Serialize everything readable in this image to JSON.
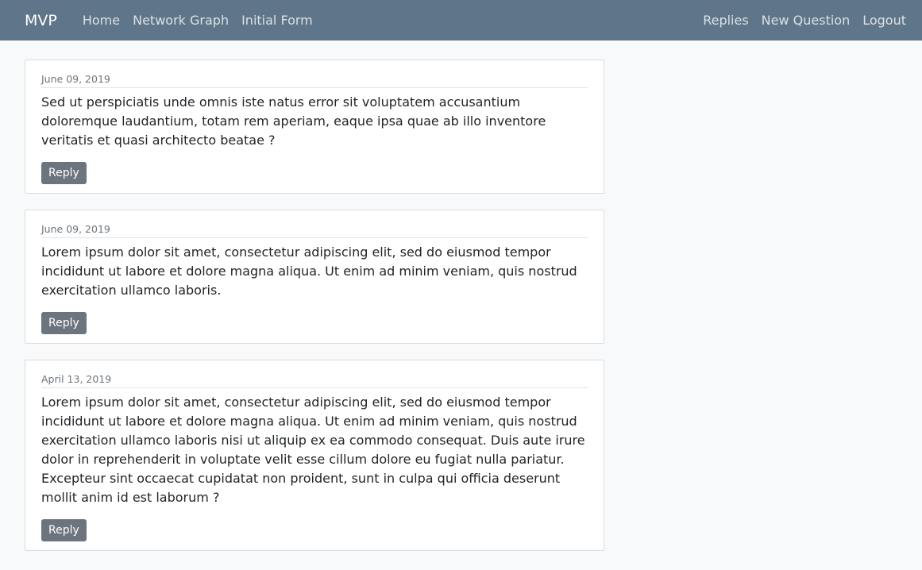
{
  "navbar": {
    "brand": "MVP",
    "left_links": [
      "Home",
      "Network Graph",
      "Initial Form"
    ],
    "right_links": [
      "Replies",
      "New Question",
      "Logout"
    ],
    "background": "#5f7589"
  },
  "questions": [
    {
      "date": "June 09, 2019",
      "text": "Sed ut perspiciatis unde omnis iste natus error sit voluptatem accusantium doloremque laudantium, totam rem aperiam, eaque ipsa quae ab illo inventore veritatis et quasi architecto beatae ?",
      "reply_label": "Reply"
    },
    {
      "date": "June 09, 2019",
      "text": "Lorem ipsum dolor sit amet, consectetur adipiscing elit, sed do eiusmod tempor incididunt ut labore et dolore magna aliqua. Ut enim ad minim veniam, quis nostrud exercitation ullamco laboris.",
      "reply_label": "Reply"
    },
    {
      "date": "April 13, 2019",
      "text": "Lorem ipsum dolor sit amet, consectetur adipiscing elit, sed do eiusmod tempor incididunt ut labore et dolore magna aliqua. Ut enim ad minim veniam, quis nostrud exercitation ullamco laboris nisi ut aliquip ex ea commodo consequat. Duis aute irure dolor in reprehenderit in voluptate velit esse cillum dolore eu fugiat nulla pariatur. Excepteur sint occaecat cupidatat non proident, sunt in culpa qui officia deserunt mollit anim id est laborum ?",
      "reply_label": "Reply"
    }
  ]
}
